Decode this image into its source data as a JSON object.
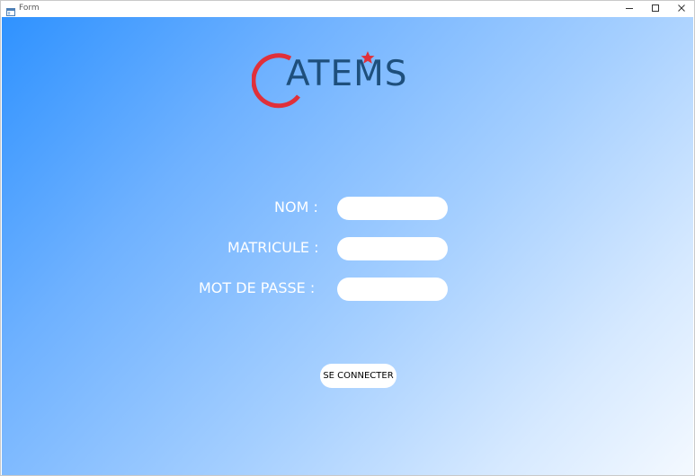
{
  "window": {
    "title": "Form"
  },
  "logo": {
    "text": "ATEMS",
    "colors": {
      "ring": "#e0303a",
      "text": "#1e4f7c",
      "star": "#e0303a"
    }
  },
  "form": {
    "nom_label": "NOM :",
    "matricule_label": "MATRICULE :",
    "password_label": "MOT DE PASSE :",
    "nom_value": "",
    "matricule_value": "",
    "password_value": "",
    "submit_label": "SE CONNECTER"
  },
  "icons": {
    "app": "form-app-icon",
    "minimize": "minimize-icon",
    "maximize": "maximize-icon",
    "close": "close-icon"
  },
  "colors": {
    "gradient_start": "#2f92ff",
    "gradient_end": "#f4f9ff",
    "field_background": "#ffffff",
    "label_text": "#ffffff"
  }
}
